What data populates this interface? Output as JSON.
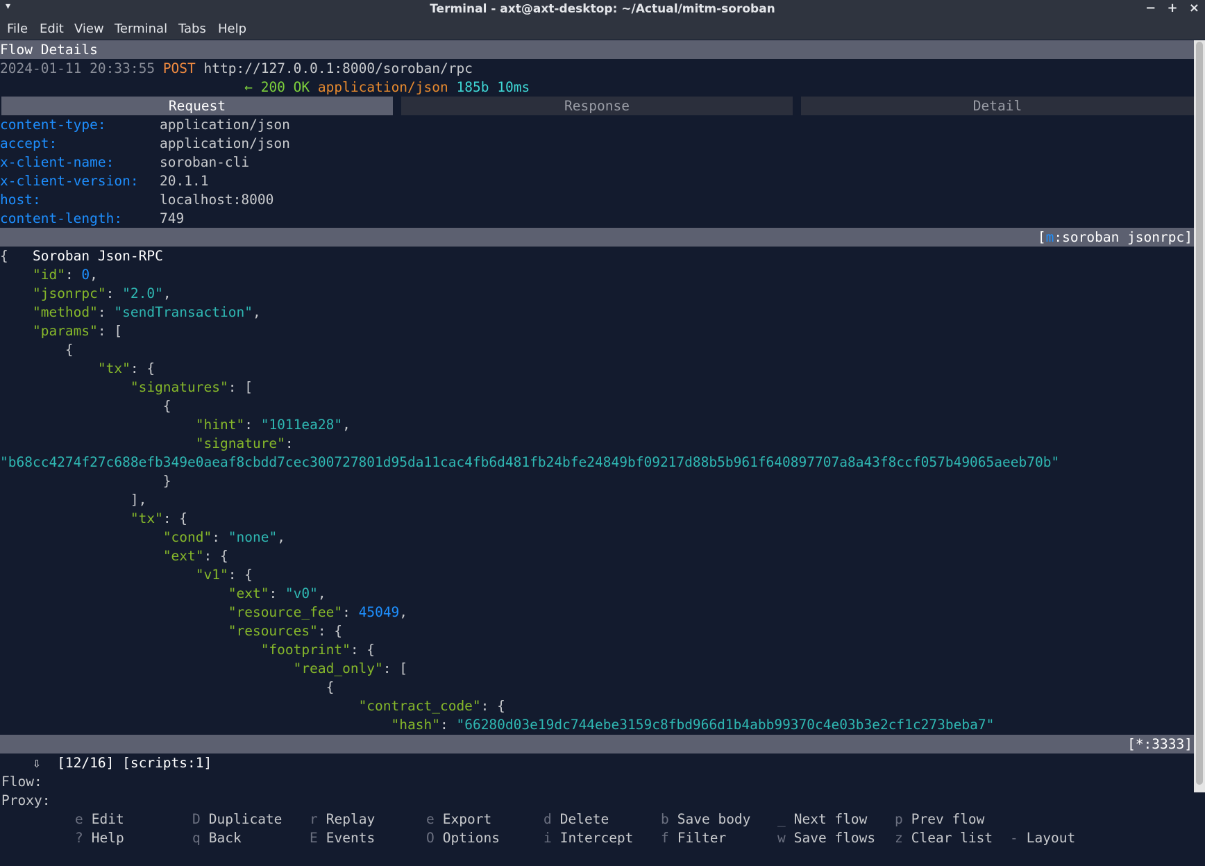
{
  "window": {
    "title": "Terminal - axt@axt-desktop: ~/Actual/mitm-soroban",
    "caret": "▾",
    "minimize": "−",
    "maximize": "+",
    "close": "×"
  },
  "menubar": [
    "File",
    "Edit",
    "View",
    "Terminal",
    "Tabs",
    "Help"
  ],
  "flow": {
    "header": "Flow Details",
    "timestamp": "2024-01-11 20:33:55",
    "method": "POST",
    "url": "http://127.0.0.1:8000/soroban/rpc",
    "arrow": "←",
    "status": "200 OK",
    "content_type": "application/json",
    "size": "185b",
    "time": "10ms"
  },
  "tabs": {
    "request": "Request",
    "response": "Response",
    "detail": "Detail"
  },
  "headers": [
    {
      "name": "content-type:",
      "value": "application/json"
    },
    {
      "name": "accept:",
      "value": "application/json"
    },
    {
      "name": "x-client-name:",
      "value": "soroban-cli"
    },
    {
      "name": "x-client-version:",
      "value": "20.1.1"
    },
    {
      "name": "host:",
      "value": "localhost:8000"
    },
    {
      "name": "content-length:",
      "value": "749"
    }
  ],
  "body_bar": {
    "title": "Soroban Json-RPC",
    "view_open": "[",
    "view_key": "m",
    "view_mode": ":soroban jsonrpc]"
  },
  "json_lines": [
    [
      [
        "p",
        "{"
      ]
    ],
    [
      [
        "p",
        "    "
      ],
      [
        "k",
        "\"id\""
      ],
      [
        "p",
        ": "
      ],
      [
        "n",
        "0"
      ],
      [
        "p",
        ","
      ]
    ],
    [
      [
        "p",
        "    "
      ],
      [
        "k",
        "\"jsonrpc\""
      ],
      [
        "p",
        ": "
      ],
      [
        "s",
        "\"2.0\""
      ],
      [
        "p",
        ","
      ]
    ],
    [
      [
        "p",
        "    "
      ],
      [
        "k",
        "\"method\""
      ],
      [
        "p",
        ": "
      ],
      [
        "s",
        "\"sendTransaction\""
      ],
      [
        "p",
        ","
      ]
    ],
    [
      [
        "p",
        "    "
      ],
      [
        "k",
        "\"params\""
      ],
      [
        "p",
        ": ["
      ]
    ],
    [
      [
        "p",
        "        {"
      ]
    ],
    [
      [
        "p",
        "            "
      ],
      [
        "k",
        "\"tx\""
      ],
      [
        "p",
        ": {"
      ]
    ],
    [
      [
        "p",
        "                "
      ],
      [
        "k",
        "\"signatures\""
      ],
      [
        "p",
        ": ["
      ]
    ],
    [
      [
        "p",
        "                    {"
      ]
    ],
    [
      [
        "p",
        "                        "
      ],
      [
        "k",
        "\"hint\""
      ],
      [
        "p",
        ": "
      ],
      [
        "s",
        "\"1011ea28\""
      ],
      [
        "p",
        ","
      ]
    ],
    [
      [
        "p",
        "                        "
      ],
      [
        "k",
        "\"signature\""
      ],
      [
        "p",
        ":"
      ]
    ],
    [
      [
        "s",
        "\"b68cc4274f27c688efb349e0aeaf8cbdd7cec300727801d95da11cac4fb6d481fb24bfe24849bf09217d88b5b961f640897707a8a43f8ccf057b49065aeeb70b\""
      ]
    ],
    [
      [
        "p",
        "                    }"
      ]
    ],
    [
      [
        "p",
        "                ],"
      ]
    ],
    [
      [
        "p",
        "                "
      ],
      [
        "k",
        "\"tx\""
      ],
      [
        "p",
        ": {"
      ]
    ],
    [
      [
        "p",
        "                    "
      ],
      [
        "k",
        "\"cond\""
      ],
      [
        "p",
        ": "
      ],
      [
        "s",
        "\"none\""
      ],
      [
        "p",
        ","
      ]
    ],
    [
      [
        "p",
        "                    "
      ],
      [
        "k",
        "\"ext\""
      ],
      [
        "p",
        ": {"
      ]
    ],
    [
      [
        "p",
        "                        "
      ],
      [
        "k",
        "\"v1\""
      ],
      [
        "p",
        ": {"
      ]
    ],
    [
      [
        "p",
        "                            "
      ],
      [
        "k",
        "\"ext\""
      ],
      [
        "p",
        ": "
      ],
      [
        "s",
        "\"v0\""
      ],
      [
        "p",
        ","
      ]
    ],
    [
      [
        "p",
        "                            "
      ],
      [
        "k",
        "\"resource_fee\""
      ],
      [
        "p",
        ": "
      ],
      [
        "n",
        "45049"
      ],
      [
        "p",
        ","
      ]
    ],
    [
      [
        "p",
        "                            "
      ],
      [
        "k",
        "\"resources\""
      ],
      [
        "p",
        ": {"
      ]
    ],
    [
      [
        "p",
        "                                "
      ],
      [
        "k",
        "\"footprint\""
      ],
      [
        "p",
        ": {"
      ]
    ],
    [
      [
        "p",
        "                                    "
      ],
      [
        "k",
        "\"read_only\""
      ],
      [
        "p",
        ": ["
      ]
    ],
    [
      [
        "p",
        "                                        {"
      ]
    ],
    [
      [
        "p",
        "                                            "
      ],
      [
        "k",
        "\"contract_code\""
      ],
      [
        "p",
        ": {"
      ]
    ],
    [
      [
        "p",
        "                                                "
      ],
      [
        "k",
        "\"hash\""
      ],
      [
        "p",
        ": "
      ],
      [
        "s",
        "\"66280d03e19dc744ebe3159c8fbd966d1b4abb99370c4e03b3e2cf1c273beba7\""
      ]
    ]
  ],
  "statusbar": {
    "left": "⇩  [12/16] [scripts:1]",
    "right": "[*:3333]"
  },
  "keybar": {
    "flow_label": "Flow:",
    "proxy_label": "Proxy:",
    "flow_keys": [
      {
        "key": "e",
        "label": "Edit"
      },
      {
        "key": "D",
        "label": "Duplicate"
      },
      {
        "key": "r",
        "label": "Replay"
      },
      {
        "key": "e",
        "label": "Export"
      },
      {
        "key": "d",
        "label": "Delete"
      },
      {
        "key": "b",
        "label": "Save body"
      },
      {
        "key": "_",
        "label": "Next flow"
      },
      {
        "key": "p",
        "label": "Prev flow"
      }
    ],
    "proxy_keys": [
      {
        "key": "?",
        "label": "Help"
      },
      {
        "key": "q",
        "label": "Back"
      },
      {
        "key": "E",
        "label": "Events"
      },
      {
        "key": "O",
        "label": "Options"
      },
      {
        "key": "i",
        "label": "Intercept"
      },
      {
        "key": "f",
        "label": "Filter"
      },
      {
        "key": "w",
        "label": "Save flows"
      },
      {
        "key": "z",
        "label": "Clear list"
      },
      {
        "key": "-",
        "label": "Layout"
      }
    ]
  },
  "colors": {
    "background": "#131b2e",
    "bar": "#5c6070",
    "key": "#1e8fff",
    "json_key": "#86b82a",
    "json_string": "#2fb8b3",
    "method": "#f08a40",
    "status_ok": "#7dd03c"
  }
}
